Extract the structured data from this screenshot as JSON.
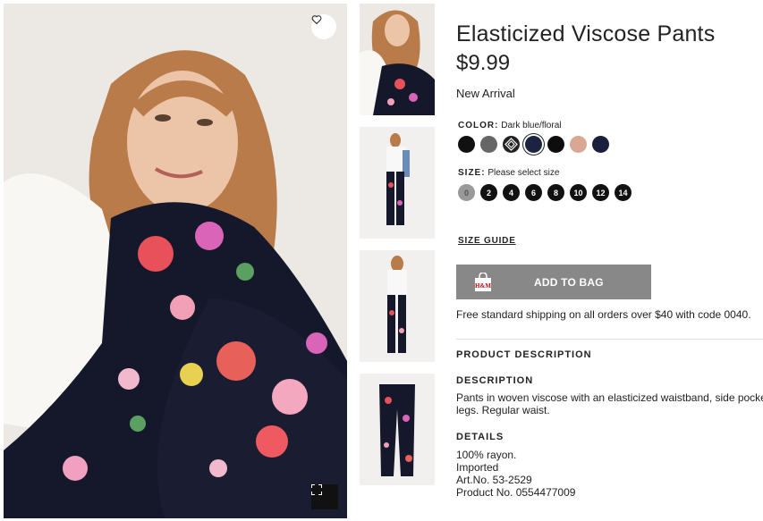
{
  "product": {
    "title": "Elasticized Viscose Pants",
    "price": "$9.99",
    "badge": "New Arrival"
  },
  "color": {
    "label": "COLOR:",
    "value": "Dark blue/floral",
    "swatches": [
      {
        "name": "black",
        "hex": "#111111"
      },
      {
        "name": "dark-gray",
        "hex": "#666666"
      },
      {
        "name": "black-white-pattern",
        "hex": "#222222"
      },
      {
        "name": "dark-blue-floral",
        "hex": "#1c2340",
        "selected": true
      },
      {
        "name": "black-2",
        "hex": "#0d0d0d"
      },
      {
        "name": "beige",
        "hex": "#d9a894"
      },
      {
        "name": "navy",
        "hex": "#1a1f3d"
      }
    ]
  },
  "size": {
    "label": "SIZE:",
    "placeholder": "Please select size",
    "options": [
      "0",
      "2",
      "4",
      "6",
      "8",
      "10",
      "12",
      "14"
    ]
  },
  "size_guide": "SIZE GUIDE",
  "add_to_bag": "ADD TO BAG",
  "shipping": "Free standard shipping on all orders over $40 with code 0040.",
  "product_description": {
    "heading": "PRODUCT DESCRIPTION",
    "description_heading": "DESCRIPTION",
    "description_lines": [
      "Pants in woven viscose with an elasticized waistband, side pocke",
      "legs. Regular waist."
    ],
    "details_heading": "DETAILS",
    "details": [
      "100% rayon.",
      "Imported",
      "Art.No. 53-2529",
      "Product No. 0554477009"
    ]
  },
  "colors": {
    "button_gray": "#888888",
    "text": "#222222"
  }
}
